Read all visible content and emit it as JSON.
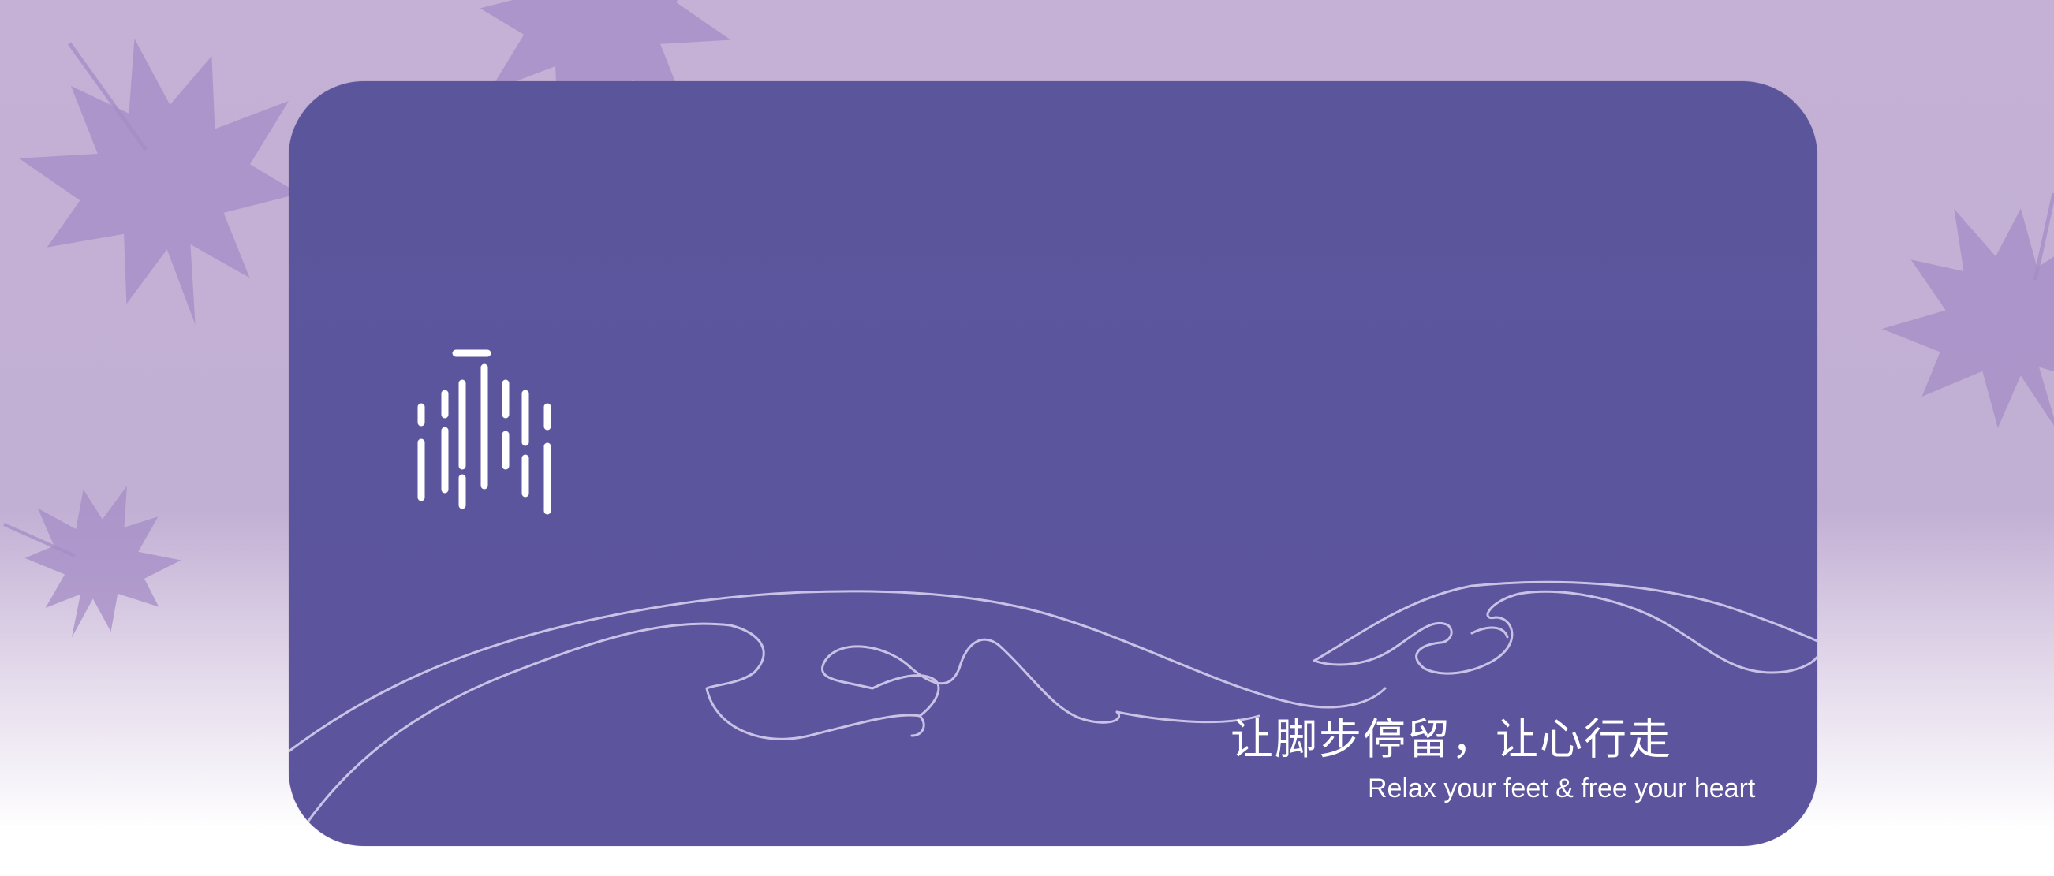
{
  "card": {
    "background_color": "#5b569b",
    "wave_line_color": "#c9c2e6"
  },
  "background": {
    "top_color": "#c4b1d5",
    "bottom_color": "#ffffff",
    "leaf_color": "#a48cc6",
    "decoration": "maple-leaf-icon"
  },
  "logo": {
    "icon": "bamboo-rain-logo-icon",
    "color": "#ffffff"
  },
  "slogan": {
    "chinese": "让脚步停留，让心行走",
    "english": "Relax your feet & free your heart"
  }
}
